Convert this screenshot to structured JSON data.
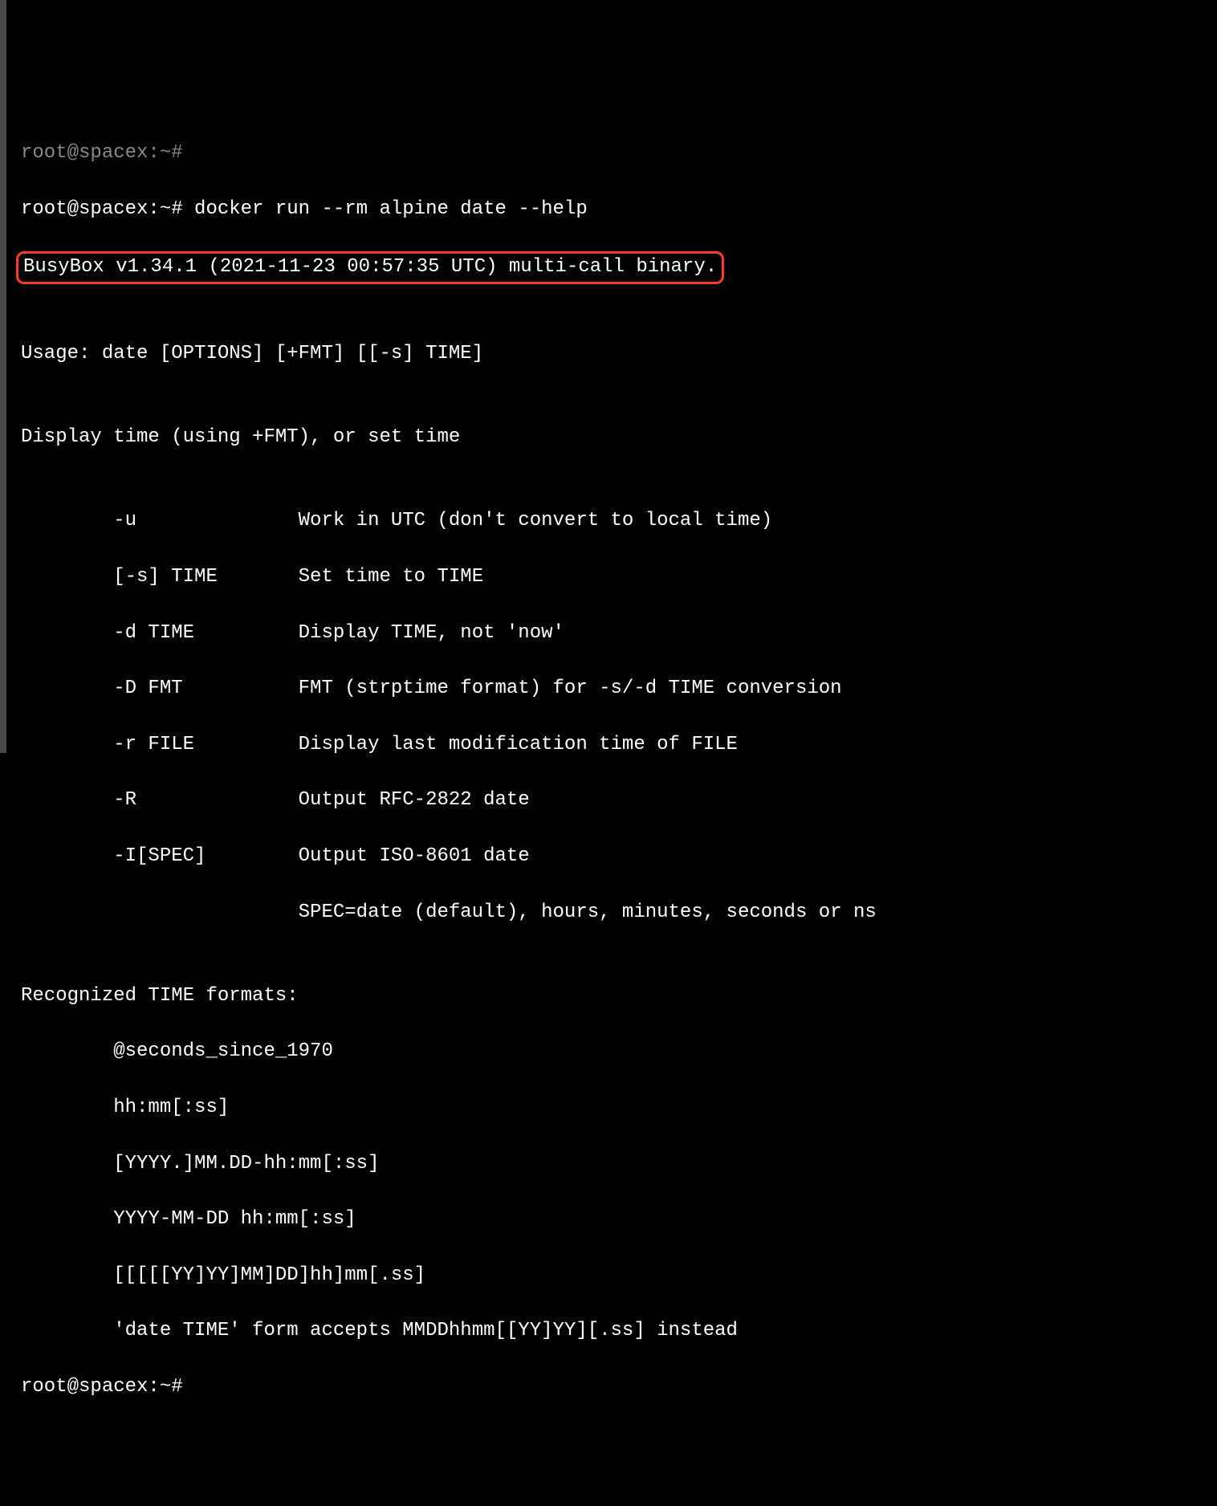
{
  "terminal": {
    "dim_prev_prompt": "root@spacex:~#",
    "prompt1": "root@spacex:~# ",
    "command": "docker run --rm alpine date --help",
    "busybox_line": "BusyBox v1.34.1 (2021-11-23 00:57:35 UTC) multi-call binary.",
    "blank1": "",
    "usage": "Usage: date [OPTIONS] [+FMT] [[-s] TIME]",
    "blank2": "",
    "desc": "Display time (using +FMT), or set time",
    "blank3": "",
    "opts": [
      "        -u              Work in UTC (don't convert to local time)",
      "        [-s] TIME       Set time to TIME",
      "        -d TIME         Display TIME, not 'now'",
      "        -D FMT          FMT (strptime format) for -s/-d TIME conversion",
      "        -r FILE         Display last modification time of FILE",
      "        -R              Output RFC-2822 date",
      "        -I[SPEC]        Output ISO-8601 date",
      "                        SPEC=date (default), hours, minutes, seconds or ns"
    ],
    "blank4": "",
    "formats_header": "Recognized TIME formats:",
    "formats": [
      "        @seconds_since_1970",
      "        hh:mm[:ss]",
      "        [YYYY.]MM.DD-hh:mm[:ss]",
      "        YYYY-MM-DD hh:mm[:ss]",
      "        [[[[[YY]YY]MM]DD]hh]mm[.ss]",
      "        'date TIME' form accepts MMDDhhmm[[YY]YY][.ss] instead"
    ],
    "prompt2": "root@spacex:~#"
  },
  "highlight_color": "#ff3b30"
}
